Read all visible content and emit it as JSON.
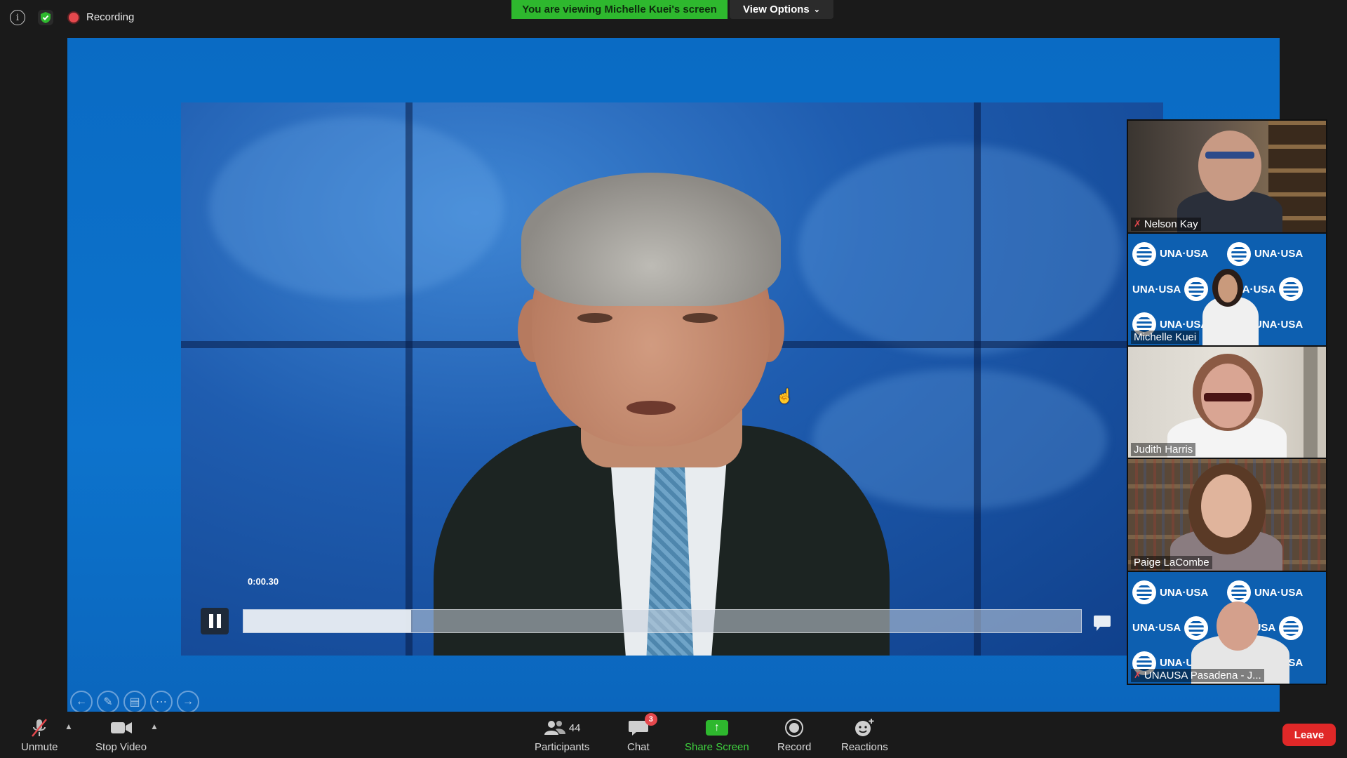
{
  "topbar": {
    "recording_label": "Recording",
    "viewing_banner": "You are viewing Michelle Kuei's screen",
    "view_options_label": "View Options"
  },
  "video": {
    "timestamp": "0:00.30",
    "progress_fraction": 0.2
  },
  "participants_panel": {
    "tiles": [
      {
        "name": "Nelson Kay",
        "muted": true
      },
      {
        "name": "Michelle Kuei",
        "muted": false
      },
      {
        "name": "Judith Harris",
        "muted": false
      },
      {
        "name": "Paige LaCombe",
        "muted": false
      },
      {
        "name": "UNAUSA Pasadena - J...",
        "muted": true
      }
    ],
    "una_text": "UNA·USA"
  },
  "toolbar": {
    "unmute_label": "Unmute",
    "stop_video_label": "Stop Video",
    "participants_label": "Participants",
    "participants_count": "44",
    "chat_label": "Chat",
    "chat_badge": "3",
    "share_screen_label": "Share Screen",
    "record_label": "Record",
    "reactions_label": "Reactions",
    "leave_label": "Leave"
  },
  "colors": {
    "accent_green": "#2eb82e",
    "leave_red": "#e02828",
    "share_blue": "#0a6bc4"
  }
}
